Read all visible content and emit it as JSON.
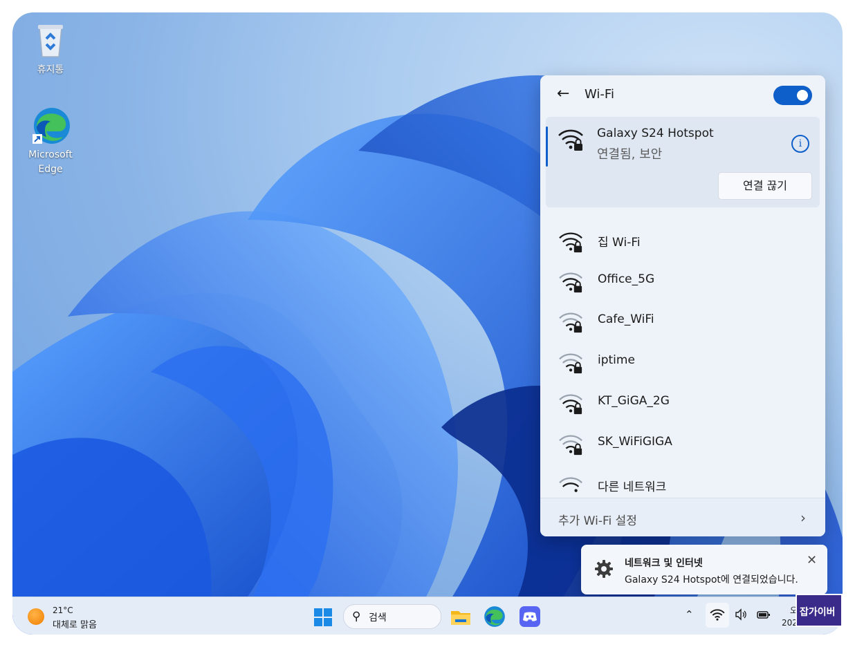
{
  "desktop": {
    "icons": [
      {
        "label": "휴지통"
      },
      {
        "label": "Microsoft Edge"
      }
    ]
  },
  "wifi_panel": {
    "title": "Wi-Fi",
    "toggle_on": true,
    "connected": {
      "name": "Galaxy S24 Hotspot",
      "status": "연결됨, 보안",
      "disconnect_label": "연결 끊기"
    },
    "networks": [
      {
        "name": "집 Wi-Fi",
        "secured": true
      },
      {
        "name": "Office_5G",
        "secured": true
      },
      {
        "name": "Cafe_WiFi",
        "secured": true
      },
      {
        "name": "iptime",
        "secured": true
      },
      {
        "name": "KT_GiGA_2G",
        "secured": true
      },
      {
        "name": "SK_WiFiGIGA",
        "secured": true
      },
      {
        "name": "다른 네트워크",
        "secured": false
      }
    ],
    "more_settings": "추가 Wi-Fi 설정"
  },
  "toast": {
    "title": "네트워크 및 인터넷",
    "body": "Galaxy S24 Hotspot에 연결되었습니다."
  },
  "taskbar": {
    "weather_temp": "21°C",
    "weather_desc": "대체로 맑음",
    "search_placeholder": "검색",
    "clock_line1": "오",
    "clock_line2": "2024"
  },
  "watermark": {
    "text": "잡가이버"
  },
  "colors": {
    "accent": "#0e5fc9",
    "panel": "#eef2f9",
    "taskbar": "#e4ecf7"
  }
}
